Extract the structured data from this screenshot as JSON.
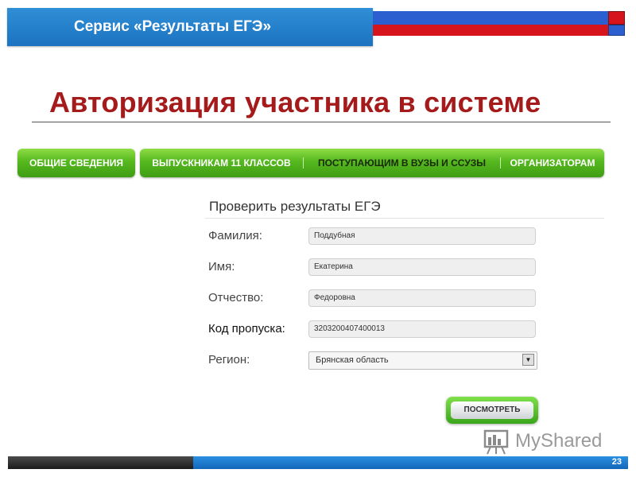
{
  "banner": {
    "title": "Сервис «Результаты ЕГЭ»"
  },
  "slide": {
    "heading": "Авторизация участника в системе",
    "page_number": "23"
  },
  "nav": {
    "general": "Общие сведения",
    "items": [
      {
        "label": "Выпускникам 11 классов",
        "active": false
      },
      {
        "label": "Поступающим в вузы и ссузы",
        "active": true
      },
      {
        "label": "Организаторам",
        "active": false
      }
    ]
  },
  "form": {
    "title": "Проверить результаты ЕГЭ",
    "fields": {
      "surname": {
        "label": "Фамилия:",
        "value": "Поддубная"
      },
      "name": {
        "label": "Имя:",
        "value": "Екатерина"
      },
      "patronymic": {
        "label": "Отчество:",
        "value": "Федоровна"
      },
      "code": {
        "label": "Код пропуска:",
        "value": "3203200407400013"
      },
      "region": {
        "label": "Регион:",
        "value": "Брянская область"
      }
    },
    "submit_label": "Посмотреть"
  },
  "watermark": {
    "text": "MyShared"
  },
  "colors": {
    "heading": "#a51a1a",
    "banner": "#1c73c1",
    "nav_green": "#55b81e",
    "flag_red": "#d5141c",
    "flag_blue": "#2b5fcf"
  }
}
